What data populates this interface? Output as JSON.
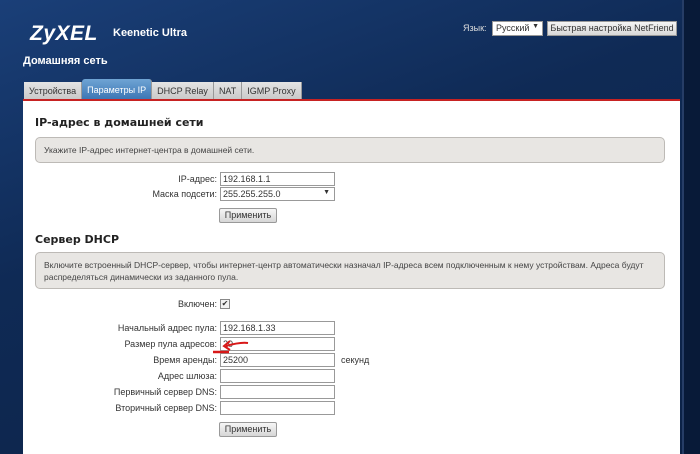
{
  "header": {
    "logo": "ZyXEL",
    "model": "Keenetic Ultra",
    "page_title": "Домашняя сеть",
    "language_label": "Язык:",
    "language_value": "Русский",
    "netfriend_button": "Быстрая настройка NetFriend"
  },
  "tabs": [
    {
      "label": "Устройства"
    },
    {
      "label": "Параметры IP",
      "active": true
    },
    {
      "label": "DHCP Relay"
    },
    {
      "label": "NAT"
    },
    {
      "label": "IGMP Proxy"
    }
  ],
  "ip_section": {
    "title": "IP-адрес в домашней сети",
    "info": "Укажите IP-адрес интернет-центра в домашней сети.",
    "ip_label": "IP-адрес:",
    "ip_value": "192.168.1.1",
    "mask_label": "Маска подсети:",
    "mask_value": "255.255.255.0",
    "apply": "Применить"
  },
  "dhcp_section": {
    "title": "Сервер DHCP",
    "info": "Включите встроенный DHCP-сервер, чтобы интернет-центр автоматически назначал IP-адреса всем подключенным к нему устройствам. Адреса будут распределяться динамически из заданного пула.",
    "enabled_label": "Включен:",
    "enabled": true,
    "fields": [
      {
        "label": "Начальный адрес пула:",
        "value": "192.168.1.33"
      },
      {
        "label": "Размер пула адресов:",
        "value": "20"
      },
      {
        "label": "Время аренды:",
        "value": "25200",
        "unit": "секунд"
      },
      {
        "label": "Адрес шлюза:",
        "value": ""
      },
      {
        "label": "Первичный сервер DNS:",
        "value": ""
      },
      {
        "label": "Вторичный сервер DNS:",
        "value": ""
      }
    ],
    "apply": "Применить"
  },
  "colors": {
    "header_bg": "#0f2a55",
    "active_tab": "#3a74b3",
    "accent_red": "#c72222",
    "annotation": "#d81818"
  }
}
